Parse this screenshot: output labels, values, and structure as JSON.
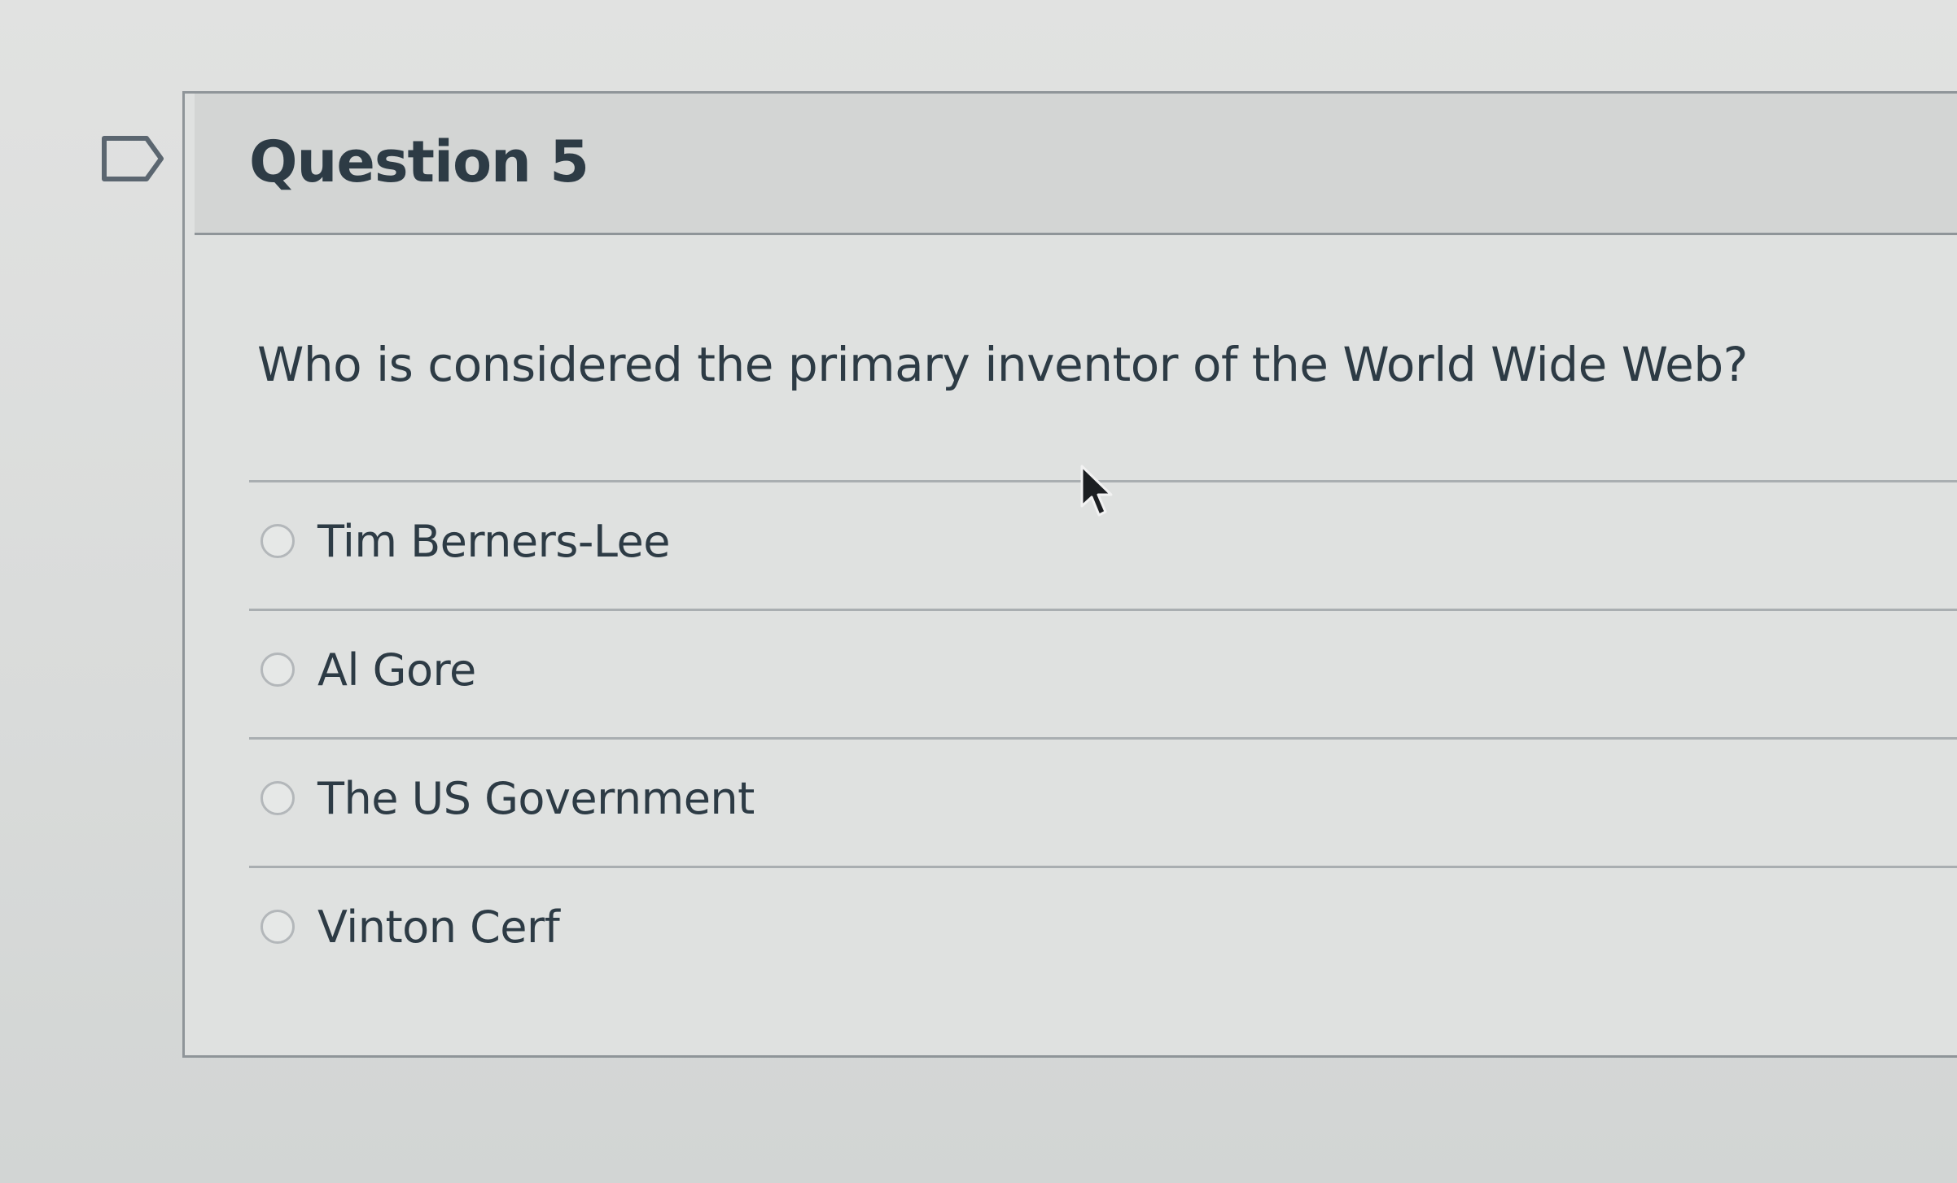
{
  "question": {
    "title": "Question 5",
    "text": "Who is considered the primary inventor of the World Wide Web?",
    "answers": [
      {
        "label": "Tim Berners-Lee",
        "selected": false
      },
      {
        "label": "Al Gore",
        "selected": false
      },
      {
        "label": "The US Government",
        "selected": false
      },
      {
        "label": "Vinton Cerf",
        "selected": false
      }
    ]
  },
  "icons": {
    "flag": "flag-question-icon",
    "cursor": "mouse-pointer-icon"
  },
  "colors": {
    "text": "#2d3b45",
    "border": "#8f9599",
    "header_bg": "#d3d5d4"
  }
}
